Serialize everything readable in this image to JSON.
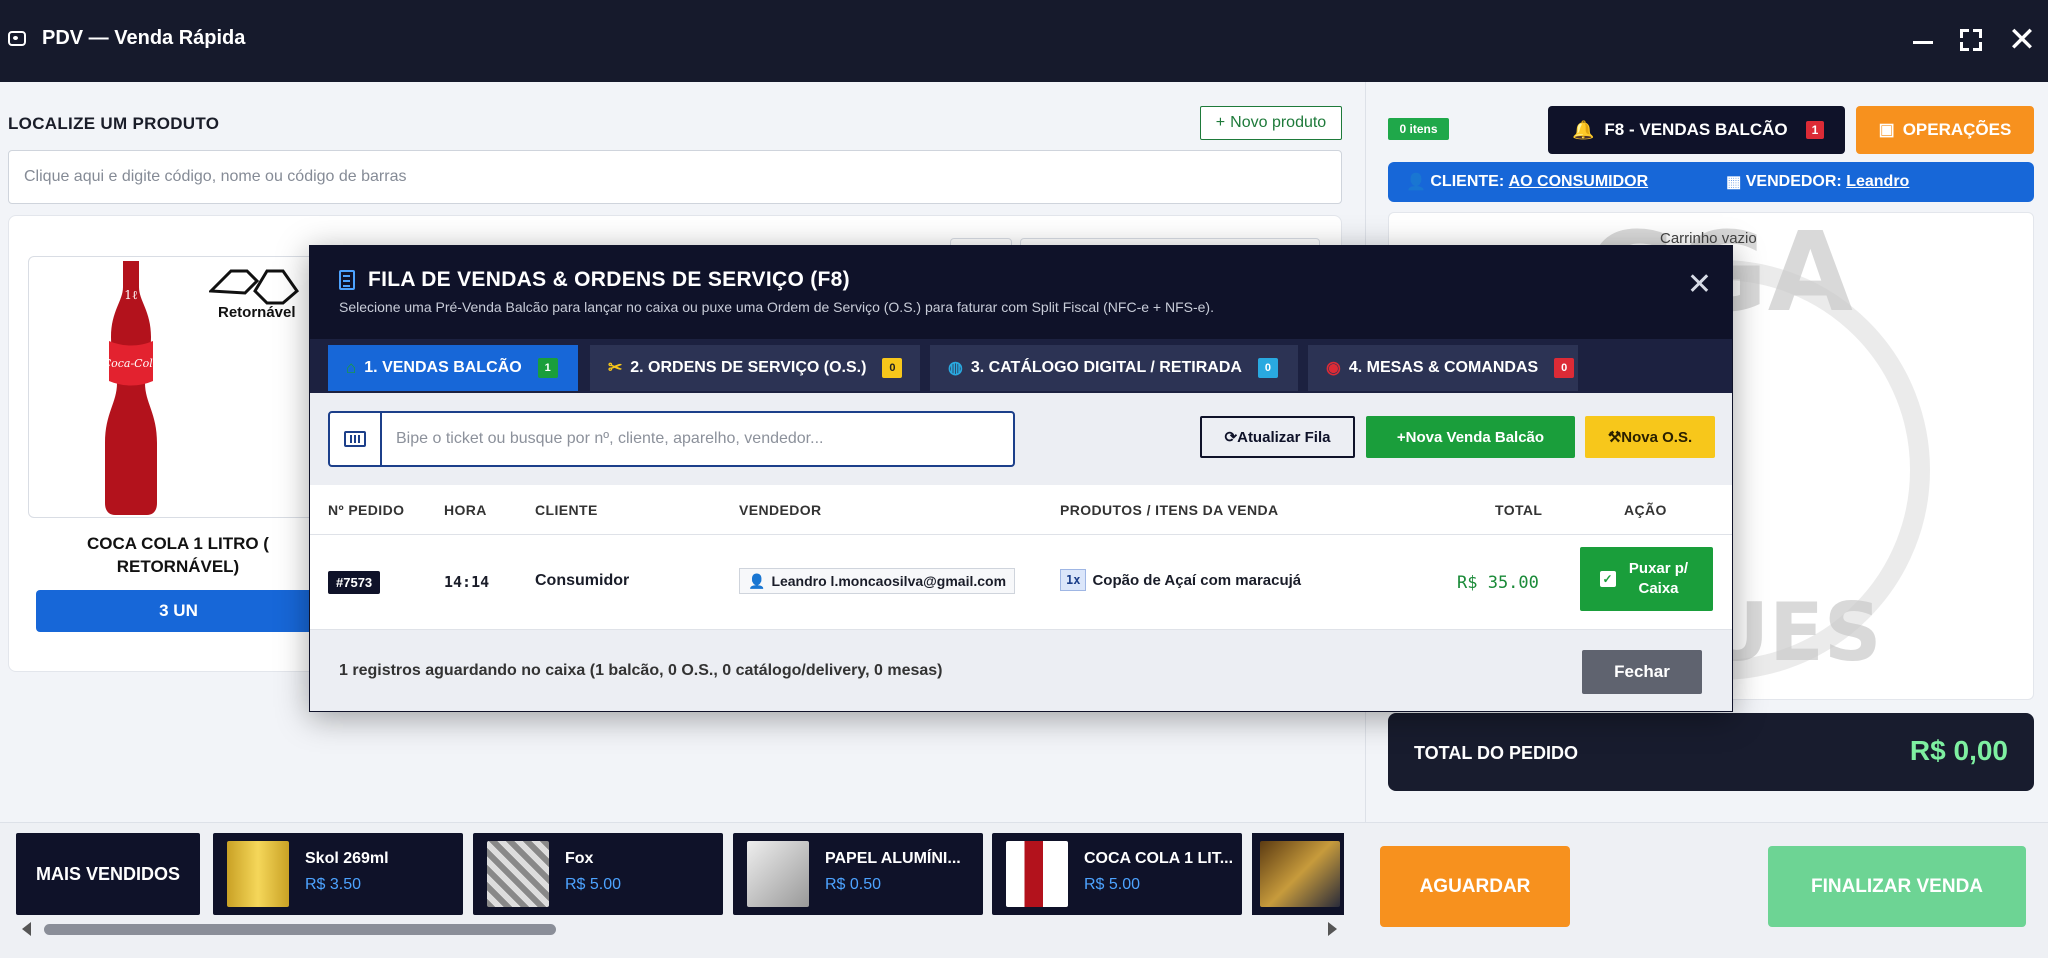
{
  "window": {
    "title": "PDV — Venda Rápida",
    "controls": {
      "minimize_icon": "minimize-icon",
      "maximize_icon": "maximize-icon",
      "close_glyph": "✕"
    }
  },
  "search": {
    "label": "LOCALIZE UM PRODUTO",
    "new_product": "Novo produto",
    "placeholder": "Clique aqui e digite código, nome ou código de barras"
  },
  "product": {
    "name": "COCA COLA 1 LITRO ( RETORNÁVEL)",
    "qty": "3 UN",
    "return_text": "Retornável",
    "bottle_text": "Coca-Cola",
    "bottle_small": "1ℓ"
  },
  "right": {
    "items_badge": "0 itens",
    "vendas_btn": "F8 -  VENDAS BALCÃO",
    "vendas_count": "1",
    "ops_btn": "OPERAÇÕES",
    "client_label": "CLIENTE:",
    "client_value": "AO CONSUMIDOR",
    "seller_label": "VENDEDOR:",
    "seller_value": "Leandro",
    "cart_empty": "Carrinho vazio",
    "watermark_top": "GGA",
    "watermark_bottom": "GUES",
    "total_label": "TOTAL DO PEDIDO",
    "total_value": "R$ 0,00"
  },
  "best_sellers": {
    "label": "MAIS VENDIDOS",
    "items": [
      {
        "name": "Skol 269ml",
        "price": "R$ 3.50"
      },
      {
        "name": "Fox",
        "price": "R$ 5.00"
      },
      {
        "name": "PAPEL ALUMÍNI...",
        "price": "R$ 0.50"
      },
      {
        "name": "COCA COLA 1 LIT...",
        "price": "R$ 5.00"
      }
    ]
  },
  "actions": {
    "wait": "AGUARDAR",
    "finish": "FINALIZAR VENDA"
  },
  "modal": {
    "title": "FILA DE VENDAS & ORDENS DE SERVIÇO (F8)",
    "subtitle": "Selecione uma Pré-Venda Balcão para lançar no caixa ou puxe uma Ordem de Serviço (O.S.) para faturar com Split Fiscal (NFC-e + NFS-e).",
    "tabs": [
      {
        "label": "1. VENDAS BALCÃO",
        "count": "1",
        "badge_color": "#1a9e3b",
        "icon": "🏠"
      },
      {
        "label": "2. ORDENS DE SERVIÇO (O.S.)",
        "count": "0",
        "badge_color": "#f7c71b",
        "icon": "✂"
      },
      {
        "label": "3. CATÁLOGO DIGITAL / RETIRADA",
        "count": "0",
        "badge_color": "#29a9e0",
        "icon": "🌐"
      },
      {
        "label": "4. MESAS & COMANDAS",
        "count": "0",
        "badge_color": "#dc2b36",
        "icon": "◉"
      }
    ],
    "ticket_placeholder": "Bipe o ticket ou busque por nº, cliente, aparelho, vendedor...",
    "refresh_btn": "Atualizar Fila",
    "new_sale_btn": "Nova Venda Balcão",
    "new_os_btn": "Nova O.S.",
    "columns": [
      "Nº PEDIDO",
      "HORA",
      "CLIENTE",
      "VENDEDOR",
      "PRODUTOS / ITENS DA VENDA",
      "TOTAL",
      "AÇÃO"
    ],
    "rows": [
      {
        "order": "#7573",
        "time": "14:14",
        "client": "Consumidor",
        "seller": "Leandro l.moncaosilva@gmail.com",
        "qty": "1x",
        "product": "Copão de Açaí com maracujá",
        "total": "R$ 35.00",
        "action": "Puxar p/ Caixa"
      }
    ],
    "summary": "1 registros aguardando no caixa (1 balcão, 0 O.S., 0 catálogo/delivery, 0 mesas)",
    "close_btn": "Fechar"
  },
  "colors": {
    "accent": "#1767d8",
    "dark": "#0f1229",
    "orange": "#f7911e",
    "green": "#1a9e3b",
    "yellow": "#f7c71b"
  }
}
